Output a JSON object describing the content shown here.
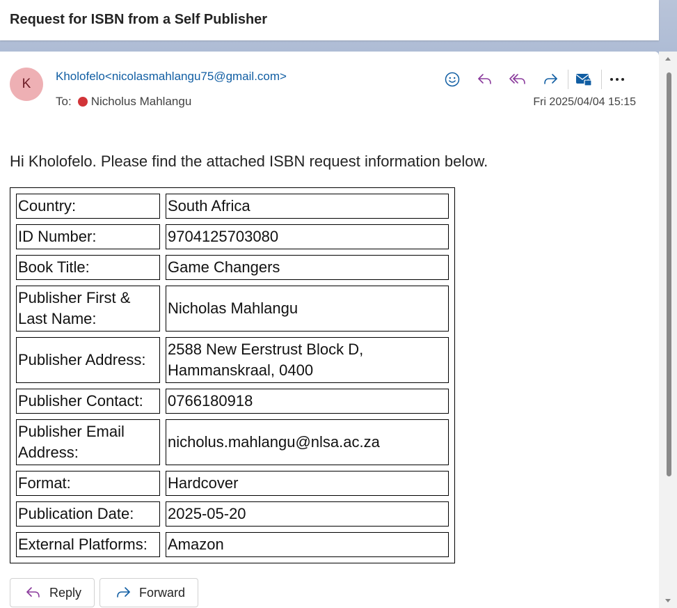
{
  "subject": "Request for ISBN from a Self Publisher",
  "avatar_initial": "K",
  "sender": "Kholofelo<nicolasmahlangu75@gmail.com>",
  "to_label": "To:",
  "recipient": "Nicholus Mahlangu",
  "date": "Fri 2025/04/04 15:15",
  "toolbar": {
    "icons": [
      "emoji-icon",
      "reply-icon",
      "reply-all-icon",
      "forward-icon",
      "encrypted-mail-icon",
      "more-icon"
    ],
    "accent_color": "#115ea3"
  },
  "body": {
    "greeting": "Hi Kholofelo. Please find the attached ISBN request information below.",
    "rows": [
      {
        "label": "Country:",
        "value": "South Africa"
      },
      {
        "label": "ID Number:",
        "value": "9704125703080"
      },
      {
        "label": "Book Title:",
        "value": "Game Changers"
      },
      {
        "label": "Publisher First & Last Name:",
        "value": "Nicholas Mahlangu"
      },
      {
        "label": "Publisher Address:",
        "value": "2588 New Eerstrust Block D, Hammanskraal, 0400"
      },
      {
        "label": "Publisher Contact:",
        "value": "0766180918"
      },
      {
        "label": "Publisher Email Address:",
        "value": "nicholus.mahlangu@nlsa.ac.za"
      },
      {
        "label": "Format:",
        "value": "Hardcover"
      },
      {
        "label": "Publication Date:",
        "value": "2025-05-20"
      },
      {
        "label": "External Platforms:",
        "value": "Amazon"
      }
    ]
  },
  "actions": {
    "reply_label": "Reply",
    "forward_label": "Forward"
  }
}
